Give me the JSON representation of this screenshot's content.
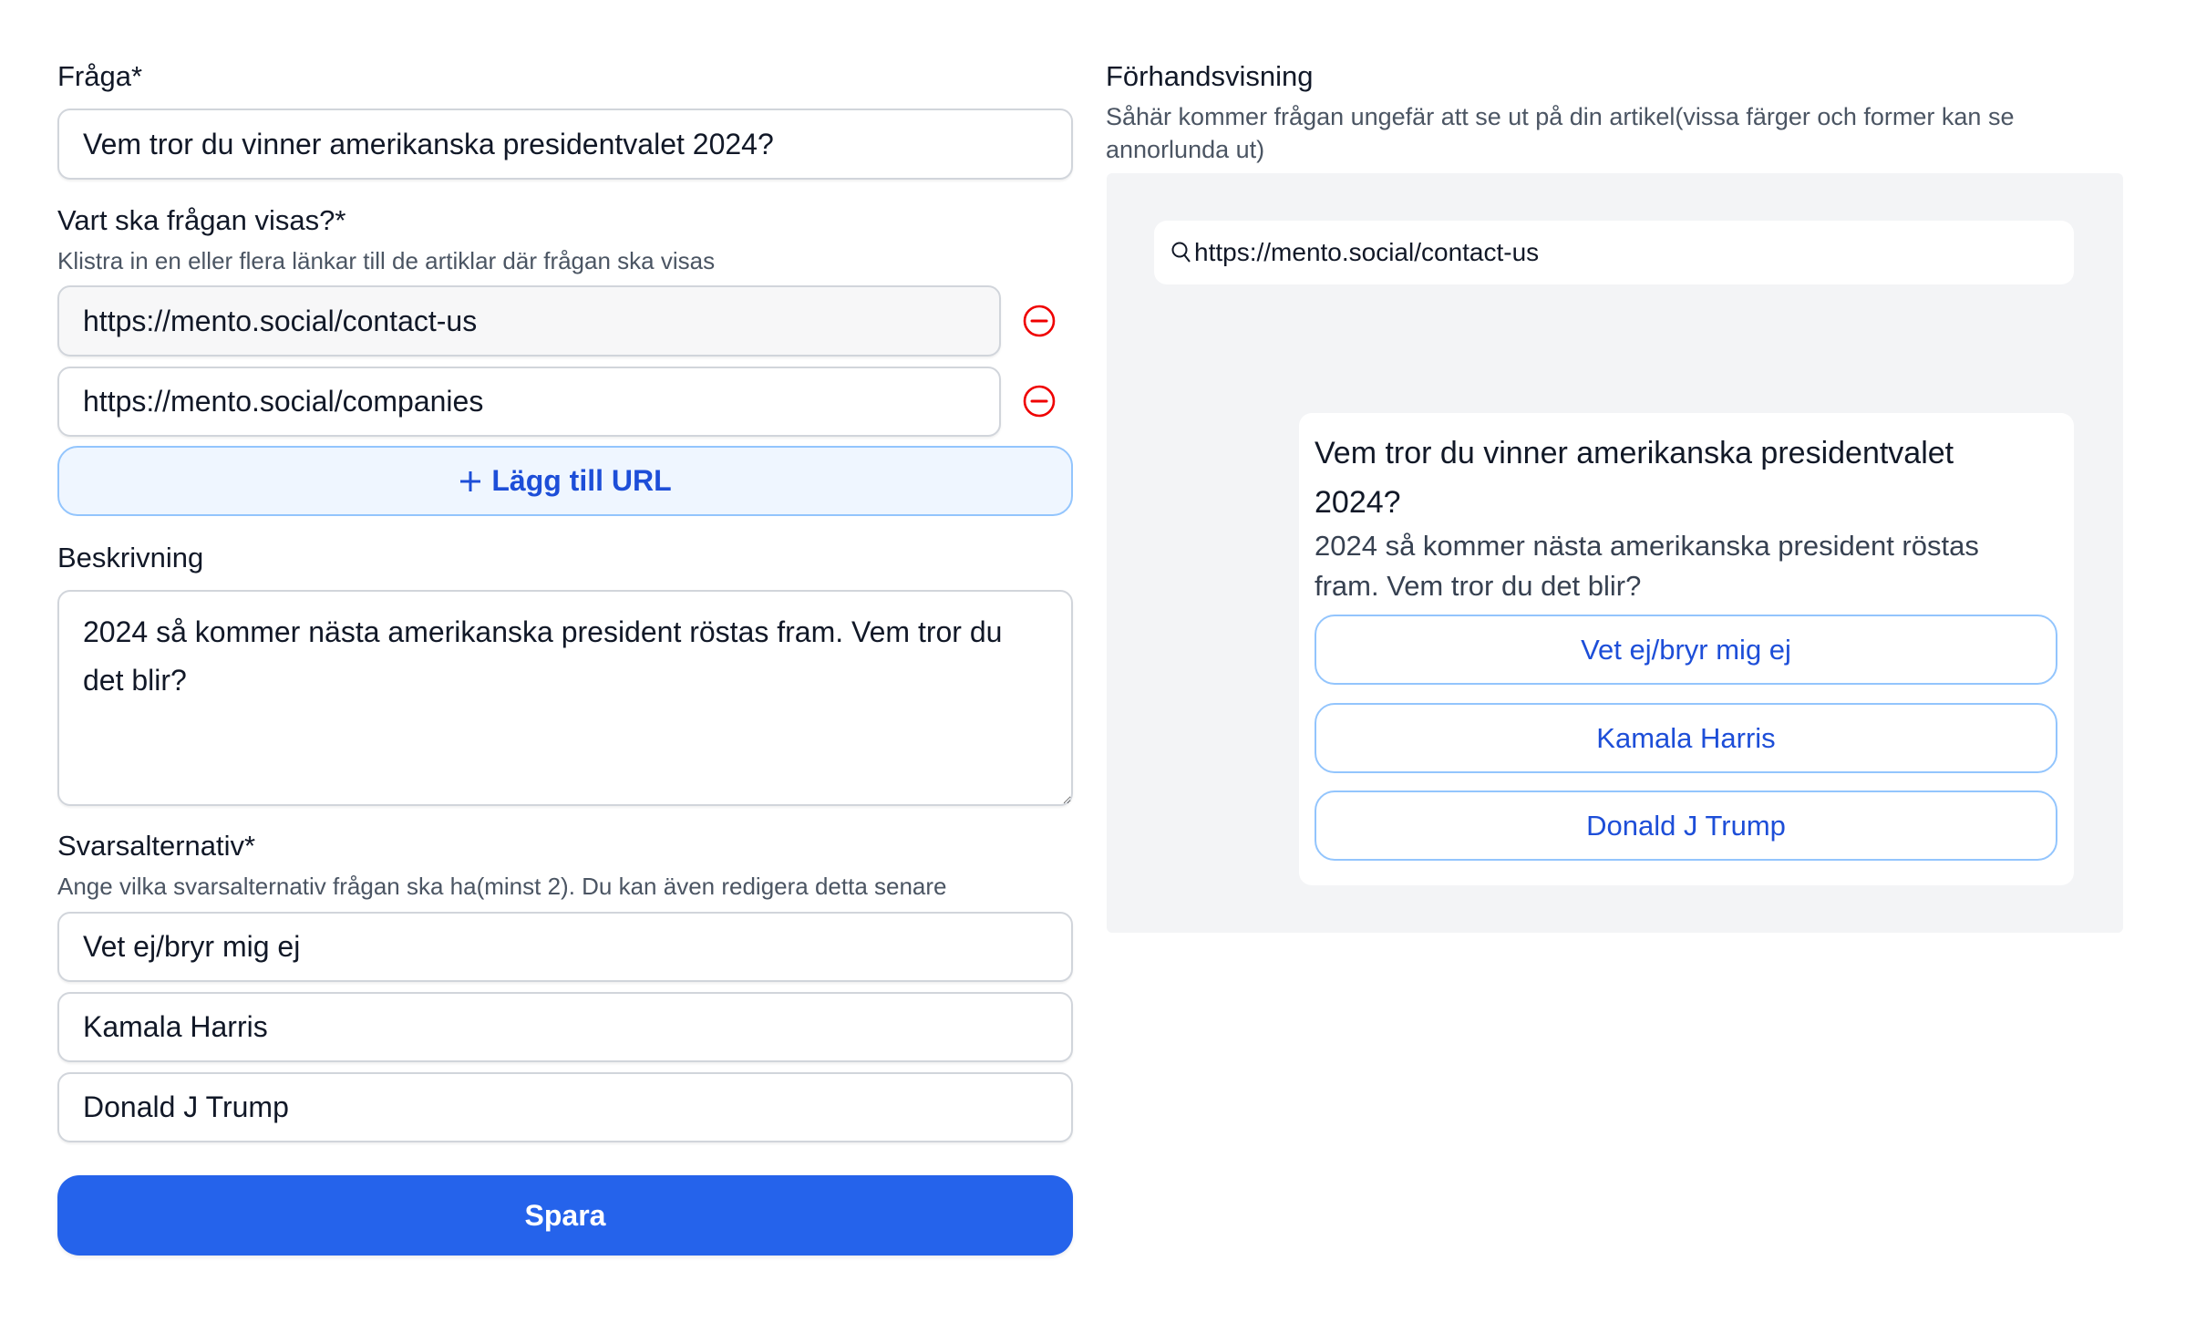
{
  "form": {
    "question": {
      "label": "Fråga*",
      "value": "Vem tror du vinner amerikanska presidentvalet 2024?"
    },
    "urls": {
      "label": "Vart ska frågan visas?*",
      "helper": "Klistra in en eller flera länkar till de artiklar där frågan ska visas",
      "items": [
        {
          "value": "https://mento.social/contact-us"
        },
        {
          "value": "https://mento.social/companies"
        }
      ],
      "add_icon": "plus-icon",
      "add_label": "Lägg till URL",
      "remove_icon": "minus-circle-icon"
    },
    "description": {
      "label": "Beskrivning",
      "value": "2024 så kommer nästa amerikanska president röstas fram. Vem tror du det blir?"
    },
    "options": {
      "label": "Svarsalternativ*",
      "helper": "Ange vilka svarsalternativ frågan ska ha(minst 2). Du kan även redigera detta senare",
      "items": [
        {
          "value": "Vet ej/bryr mig ej"
        },
        {
          "value": "Kamala Harris"
        },
        {
          "value": "Donald J Trump"
        }
      ]
    },
    "save_label": "Spara"
  },
  "preview": {
    "title": "Förhandsvisning",
    "description": "Såhär kommer frågan ungefär att se ut på din artikel(vissa färger och former kan se annorlunda ut)",
    "search_icon": "search-icon",
    "search_url": "https://mento.social/contact-us",
    "card": {
      "question": "Vem tror du vinner amerikanska presidentvalet 2024?",
      "description": "2024 så kommer nästa amerikanska president röstas fram. Vem tror du det blir?",
      "options": [
        "Vet ej/bryr mig ej",
        "Kamala Harris",
        "Donald J Trump"
      ]
    }
  },
  "colors": {
    "primary": "#2563eb",
    "accent_text": "#1d4ed8",
    "danger": "#ef0000",
    "preview_bg": "#f3f4f6"
  }
}
